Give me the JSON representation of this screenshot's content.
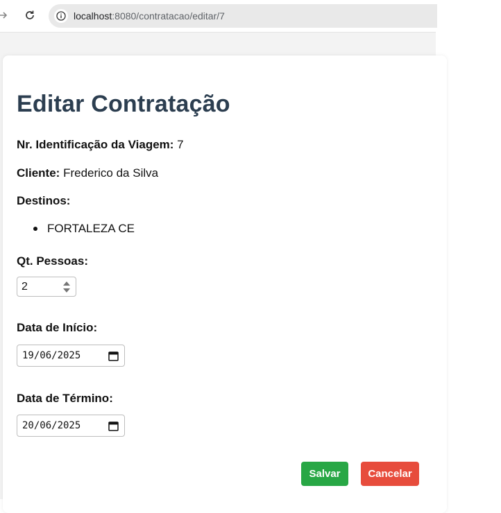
{
  "browser": {
    "url_host": "localhost",
    "url_path": ":8080/contratacao/editar/7"
  },
  "page": {
    "title": "Editar Contratação",
    "trip_id_label": "Nr. Identificação da Viagem:",
    "trip_id_value": "7",
    "client_label": "Cliente:",
    "client_value": "Frederico da Silva",
    "destinations_label": "Destinos:",
    "destinations": [
      "FORTALEZA CE"
    ],
    "people_label": "Qt. Pessoas:",
    "people_value": "2",
    "start_label": "Data de Início:",
    "start_value": "19/06/2025",
    "end_label": "Data de Término:",
    "end_value": "20/06/2025",
    "save_label": "Salvar",
    "cancel_label": "Cancelar"
  },
  "colors": {
    "title": "#2c3e50",
    "save": "#28a745",
    "cancel": "#e74c3c"
  }
}
